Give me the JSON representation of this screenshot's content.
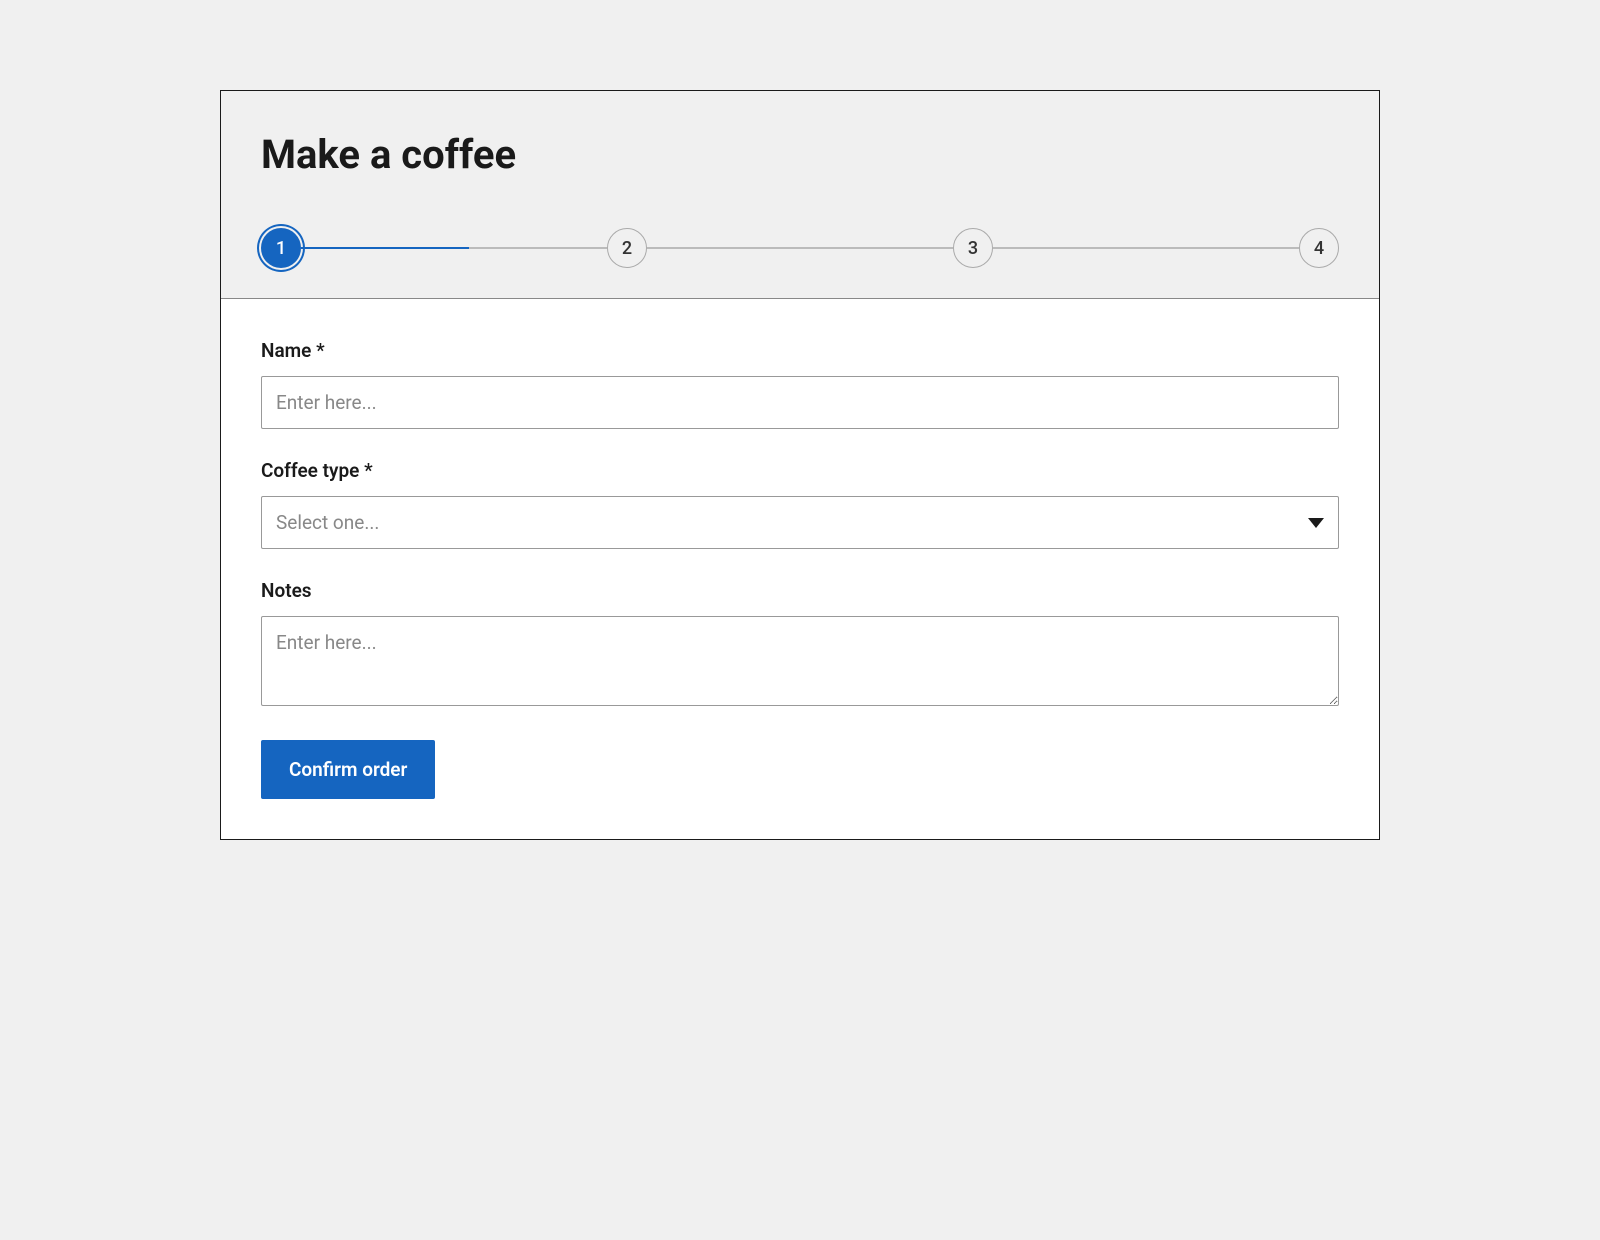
{
  "title": "Make a coffee",
  "stepper": {
    "steps": [
      "1",
      "2",
      "3",
      "4"
    ],
    "activeIndex": 0,
    "progressPercent": 55
  },
  "form": {
    "name": {
      "label": "Name *",
      "placeholder": "Enter here..."
    },
    "coffeeType": {
      "label": "Coffee type *",
      "placeholder": "Select one..."
    },
    "notes": {
      "label": "Notes",
      "placeholder": "Enter here..."
    },
    "submitLabel": "Confirm order"
  },
  "colors": {
    "primary": "#1565c0"
  }
}
